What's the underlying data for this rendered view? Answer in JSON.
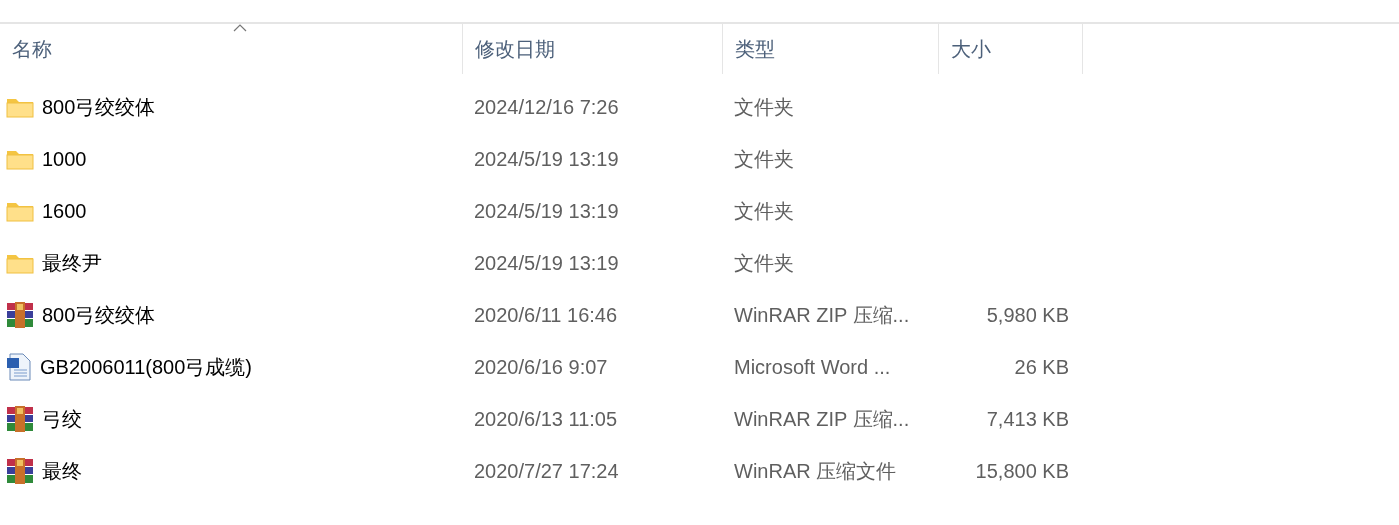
{
  "columns": [
    {
      "label": "名称",
      "sorted": true
    },
    {
      "label": "修改日期",
      "sorted": false
    },
    {
      "label": "类型",
      "sorted": false
    },
    {
      "label": "大小",
      "sorted": false
    }
  ],
  "files": [
    {
      "kind": "folder",
      "name": "800弓绞绞体",
      "modified": "2024/12/16 7:26",
      "type": "文件夹"
    },
    {
      "kind": "folder",
      "name": "1000",
      "modified": "2024/5/19 13:19",
      "type": "文件夹"
    },
    {
      "kind": "folder",
      "name": "1600",
      "modified": "2024/5/19 13:19",
      "type": "文件夹"
    },
    {
      "kind": "folder",
      "name": "最终尹",
      "modified": "2024/5/19 13:19",
      "type": "文件夹"
    },
    {
      "kind": "archive",
      "name": "800弓绞绞体",
      "modified": "2020/6/11 16:46",
      "type": "WinRAR ZIP 压缩...",
      "size": "5,980 KB"
    },
    {
      "kind": "document",
      "name": "GB2006011(800弓成缆)",
      "modified": "2020/6/16 9:07",
      "type": "Microsoft Word ...",
      "size": "26 KB"
    },
    {
      "kind": "archive",
      "name": "弓绞",
      "modified": "2020/6/13 11:05",
      "type": "WinRAR ZIP 压缩...",
      "size": "7,413 KB"
    },
    {
      "kind": "archive",
      "name": "最终",
      "modified": "2020/7/27 17:24",
      "type": "WinRAR 压缩文件",
      "size": "15,800 KB"
    }
  ]
}
